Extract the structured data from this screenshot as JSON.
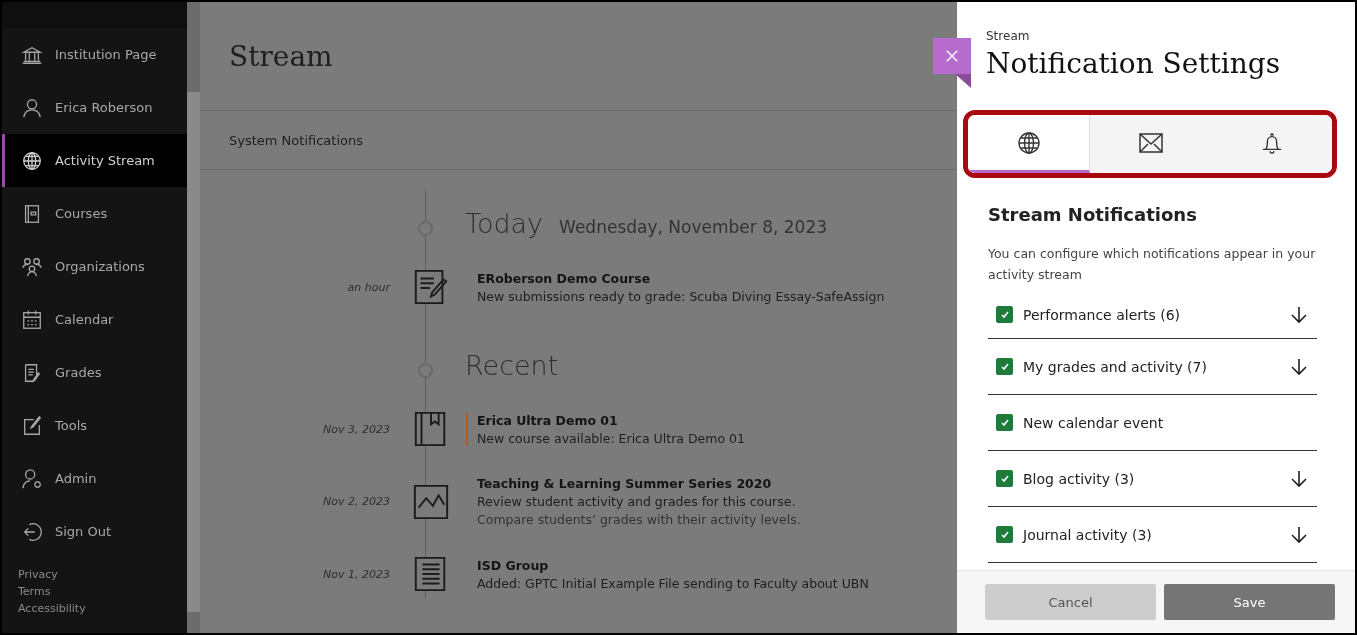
{
  "sidebar": {
    "items": [
      {
        "label": "Institution Page",
        "kind": "institution",
        "selected": false
      },
      {
        "label": "Erica Roberson",
        "kind": "person",
        "selected": false
      },
      {
        "label": "Activity Stream",
        "kind": "globe",
        "selected": true
      },
      {
        "label": "Courses",
        "kind": "courses",
        "selected": false
      },
      {
        "label": "Organizations",
        "kind": "organizations",
        "selected": false
      },
      {
        "label": "Calendar",
        "kind": "calendar",
        "selected": false
      },
      {
        "label": "Grades",
        "kind": "grades",
        "selected": false
      },
      {
        "label": "Tools",
        "kind": "tools",
        "selected": false
      },
      {
        "label": "Admin",
        "kind": "admin",
        "selected": false
      },
      {
        "label": "Sign Out",
        "kind": "signout",
        "selected": false
      }
    ],
    "footer_links": [
      "Privacy",
      "Terms",
      "Accessibility"
    ]
  },
  "main": {
    "title": "Stream",
    "filter": "System Notifications",
    "sections": [
      {
        "heading": "Today",
        "date": "Wednesday, November 8, 2023",
        "entries": [
          {
            "time": "an hour",
            "kind": "submission",
            "unread": false,
            "title": "ERoberson Demo Course",
            "lines": [
              "New submissions ready to grade: Scuba Diving Essay-SafeAssign"
            ]
          }
        ]
      },
      {
        "heading": "Recent",
        "entries": [
          {
            "time": "Nov 3, 2023",
            "kind": "course",
            "unread": true,
            "title": "Erica Ultra Demo 01",
            "lines": [
              "New course available: Erica Ultra Demo 01"
            ]
          },
          {
            "time": "Nov 2, 2023",
            "kind": "chart",
            "unread": false,
            "title": "Teaching & Learning Summer Series 2020",
            "lines": [
              "Review student activity and grades for this course.",
              "Compare students’ grades with their activity levels."
            ]
          },
          {
            "time": "Nov 1, 2023",
            "kind": "document",
            "unread": false,
            "title": "ISD Group",
            "lines": [
              "Added: GPTC Initial Example File sending to Faculty about UBN"
            ]
          }
        ]
      }
    ]
  },
  "panel": {
    "breadcrumb": "Stream",
    "title": "Notification Settings",
    "tabs": [
      {
        "kind": "globe",
        "selected": true
      },
      {
        "kind": "envelope",
        "selected": false
      },
      {
        "kind": "bell",
        "selected": false
      }
    ],
    "section_title": "Stream Notifications",
    "description": "You can configure which notifications appear in your activity stream",
    "options": [
      {
        "label": "Performance alerts (6)",
        "checked": true,
        "expandable": true
      },
      {
        "label": "My grades and activity (7)",
        "checked": true,
        "expandable": true
      },
      {
        "label": "New calendar event",
        "checked": true,
        "expandable": false
      },
      {
        "label": "Blog activity (3)",
        "checked": true,
        "expandable": true
      },
      {
        "label": "Journal activity (3)",
        "checked": true,
        "expandable": true
      }
    ],
    "buttons": [
      {
        "label": "Cancel",
        "kind": "secondary"
      },
      {
        "label": "Save",
        "kind": "primary"
      }
    ]
  }
}
